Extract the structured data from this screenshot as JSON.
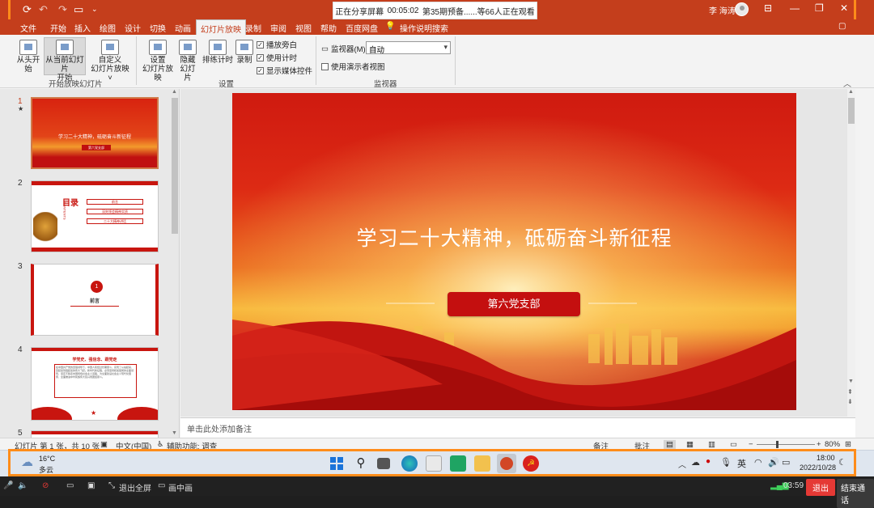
{
  "share_bar": {
    "status": "正在分享屏幕",
    "timer": "00:05:02",
    "viewers": "第35期预备......等66人正在观看"
  },
  "titlebar": {
    "user_name": "李 海涛"
  },
  "tabs": [
    "文件",
    "开始",
    "插入",
    "绘图",
    "设计",
    "切换",
    "动画",
    "幻灯片放映",
    "录制",
    "审阅",
    "视图",
    "帮助",
    "百度网盘"
  ],
  "tell_me": "操作说明搜索",
  "ribbon": {
    "from_start": "从头开始",
    "from_current": [
      "从当前幻灯片",
      "开始"
    ],
    "custom": [
      "自定义",
      "幻灯片放映 ˅"
    ],
    "group_start": "开始放映幻灯片",
    "setup": [
      "设置",
      "幻灯片放映"
    ],
    "hide": [
      "隐藏",
      "幻灯片"
    ],
    "rehearse": "排练计时",
    "record": "录制",
    "opt_narration": "播放旁白",
    "opt_timings": "使用计时",
    "opt_media": "显示媒体控件",
    "group_setup": "设置",
    "monitor_label": "监视器(M):",
    "monitor_value": "自动",
    "presenter_view": "使用演示者视图",
    "group_monitor": "监视器"
  },
  "thumbnails": {
    "nums": [
      "1",
      "2",
      "3",
      "4",
      "5"
    ],
    "star": "★",
    "t1_title": "学习二十大精神，砥砺奋斗新征程",
    "t1_sub": "第六党支部",
    "t2_title": "目录",
    "t2_en": "CONTENTS",
    "t2_items": [
      "前言",
      "深刻领会精神实质",
      "二十大精神讲话"
    ],
    "t3_num": "1",
    "t3_title": "前言",
    "t4_title": "学党史、强信念、跟党走",
    "t4_body": "在中国共产党的坚强领导下，中国人民经过长期奋斗，实现了从站起来、富起来到强起来的伟大飞跃。新时代新征程，必须坚持和加强党的全面领导，坚定不移走中国特色社会主义道路，为全面建设社会主义现代化国家、全面推进中华民族伟大复兴而团结奋斗。"
  },
  "slide": {
    "title": "学习二十大精神，砥砺奋斗新征程",
    "button": "第六党支部"
  },
  "notes_placeholder": "单击此处添加备注",
  "status": {
    "slide_info": "幻灯片 第 1 张，共 10 张",
    "language": "中文(中国)",
    "accessibility": "辅助功能: 调查",
    "notes": "备注",
    "comments": "批注",
    "zoom": "80%"
  },
  "taskbar": {
    "temp": "16°C",
    "weather": "多云",
    "ime": "英",
    "time": "18:00",
    "date": "2022/10/28"
  },
  "meeting_bar": {
    "fullscreen": "退出全屏",
    "pip": "画中画",
    "time": "03:59",
    "exit": "退出",
    "end_call": "结束通话"
  }
}
